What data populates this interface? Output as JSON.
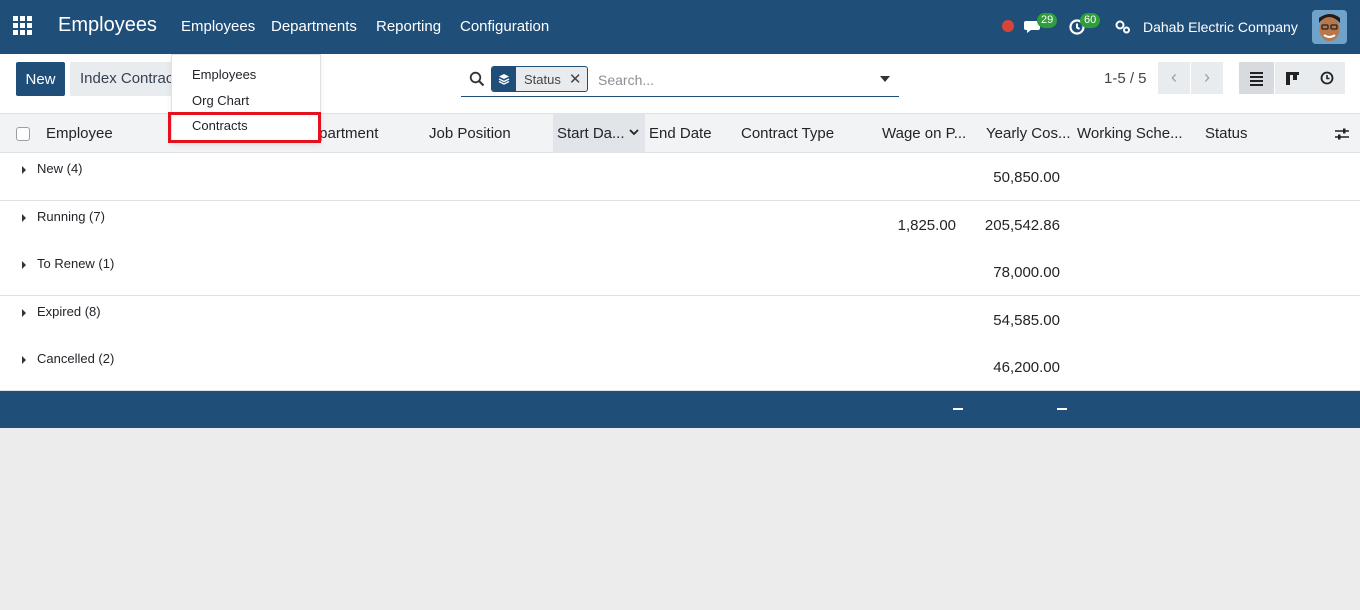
{
  "navbar": {
    "app_title": "Employees",
    "menus": [
      "Employees",
      "Departments",
      "Reporting",
      "Configuration"
    ],
    "messages_badge": "29",
    "activities_badge": "60",
    "company_name": "Dahab Electric Company",
    "accent_color": "#1f4e79"
  },
  "control": {
    "new_label": "New",
    "index_label": "Index Contracts",
    "facet_label": "Status",
    "search_placeholder": "Search...",
    "pager": "1-5 / 5"
  },
  "dropdown": {
    "items": [
      "Employees",
      "Org Chart",
      "Contracts"
    ],
    "highlighted_item": "Contracts"
  },
  "table": {
    "columns": [
      "Employee",
      "Department",
      "Job Position",
      "Start Da...",
      "End Date",
      "Contract Type",
      "Wage on P...",
      "Yearly Cos...",
      "Working Sche...",
      "Status"
    ],
    "sorted_column": "Start Date",
    "groups": [
      {
        "label": "New (4)",
        "wage": "",
        "yearly": "50,850.00"
      },
      {
        "label": "Running (7)",
        "wage": "1,825.00",
        "yearly": "205,542.86"
      },
      {
        "label": "To Renew (1)",
        "wage": "",
        "yearly": "78,000.00"
      },
      {
        "label": "Expired (8)",
        "wage": "",
        "yearly": "54,585.00"
      },
      {
        "label": "Cancelled (2)",
        "wage": "",
        "yearly": "46,200.00"
      }
    ],
    "footer_wage": "–",
    "footer_yearly": "–"
  }
}
